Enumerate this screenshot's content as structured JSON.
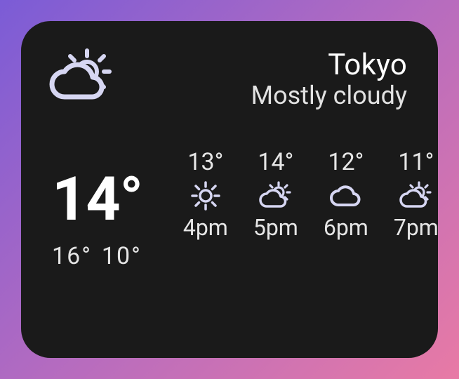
{
  "location": "Tokyo",
  "condition": "Mostly cloudy",
  "current_icon": "partly-cloudy",
  "current_temp": "14°",
  "high": "16°",
  "low": "10°",
  "hourly": [
    {
      "temp": "13°",
      "icon": "sunny",
      "time": "4pm"
    },
    {
      "temp": "14°",
      "icon": "partly-cloudy",
      "time": "5pm"
    },
    {
      "temp": "12°",
      "icon": "cloudy",
      "time": "6pm"
    },
    {
      "temp": "11°",
      "icon": "partly-cloudy",
      "time": "7pm"
    }
  ]
}
